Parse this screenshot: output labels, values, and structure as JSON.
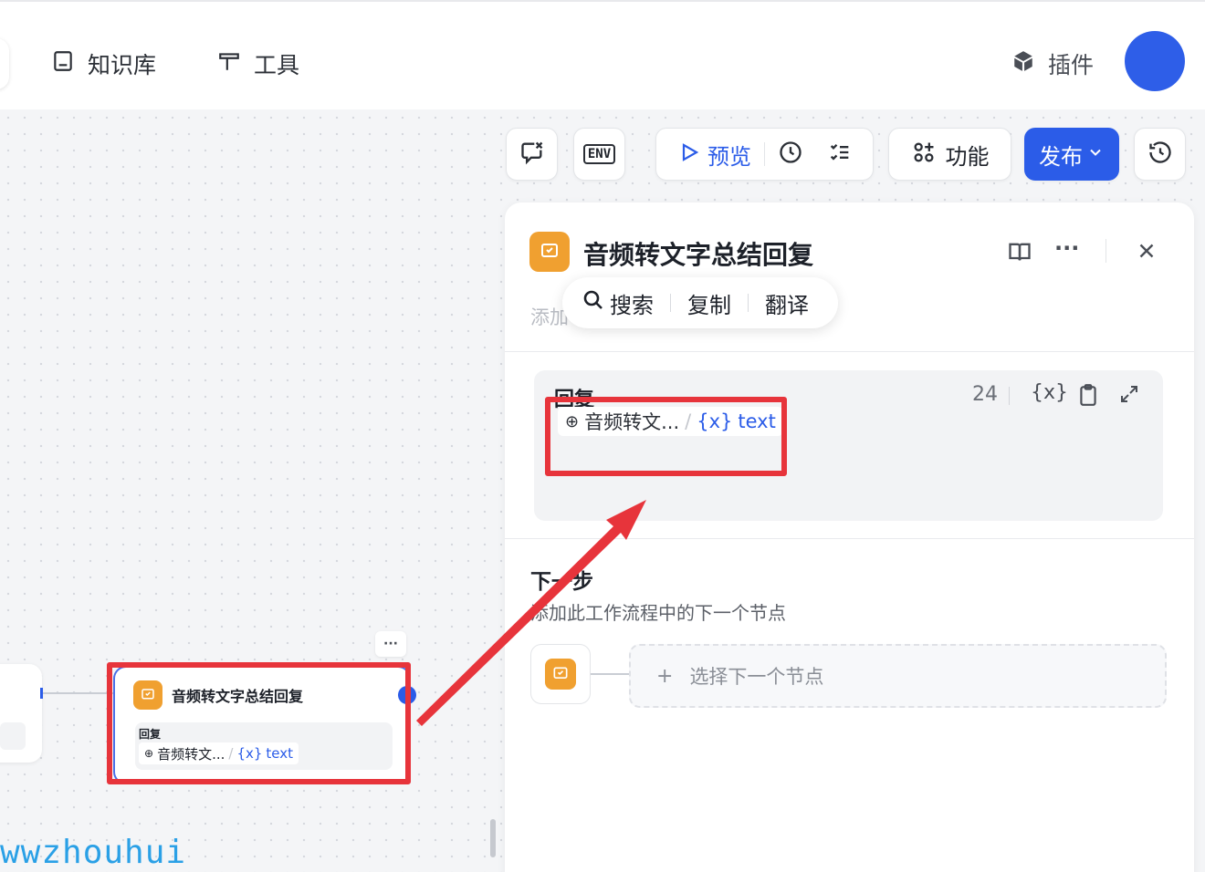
{
  "nav": {
    "knowledge_base": "知识库",
    "tools": "工具",
    "plugins": "插件"
  },
  "toolbar": {
    "env_label": "ENV",
    "preview": "预览",
    "features": "功能",
    "publish": "发布"
  },
  "panel": {
    "node_title": "音频转文字总结回复",
    "description_placeholder": "添加",
    "reply_label": "回复",
    "reply_count": "24",
    "reply_variable": {
      "node": "音频转文...",
      "separator": "/",
      "var_icon": "{x}",
      "var_name": "text"
    },
    "next_step_title": "下一步",
    "next_step_desc": "添加此工作流程中的下一个节点",
    "select_next_node": "选择下一个节点"
  },
  "context_menu": {
    "search": "搜索",
    "copy": "复制",
    "translate": "翻译"
  },
  "canvas_node": {
    "title": "音频转文字总结回复",
    "reply_label": "回复",
    "node_ref": "音频转文...",
    "separator": "/",
    "var_icon": "{x}",
    "var_name": "text",
    "more": "···"
  },
  "watermark": "wwzhouhui",
  "colors": {
    "accent": "#2b5ce8",
    "node_orange": "#f0a030",
    "annotation_red": "#e7343b"
  }
}
